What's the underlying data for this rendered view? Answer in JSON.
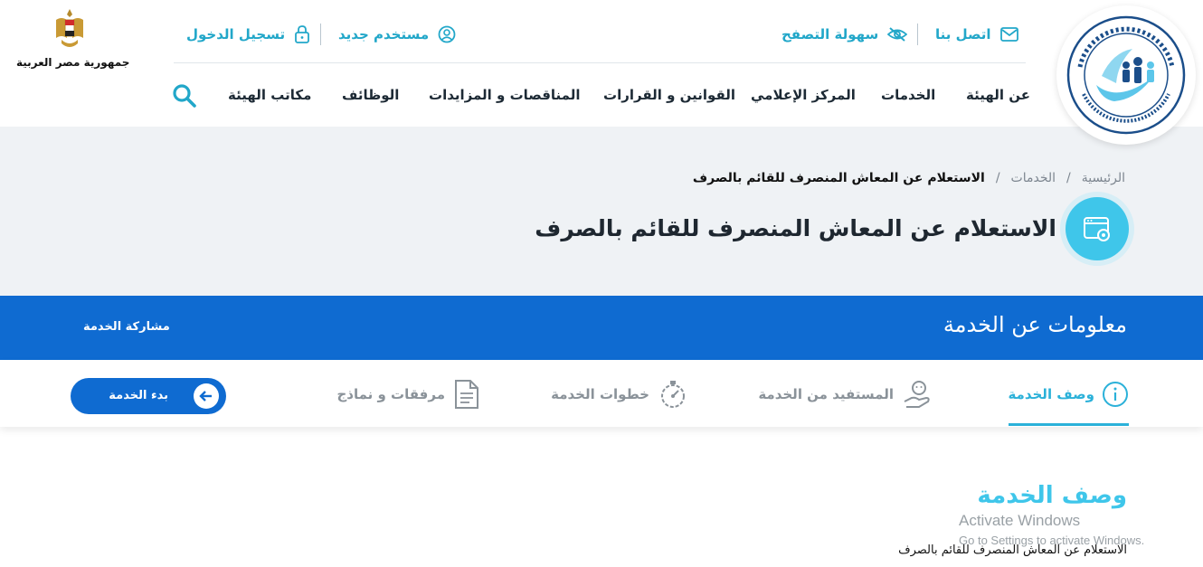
{
  "topbar": {
    "contact": "اتصل بنا",
    "accessibility": "سهولة التصفح",
    "new_user": "مستخدم جديد",
    "login": "تسجيل الدخول"
  },
  "nav": {
    "items": [
      "عن الهيئة",
      "الخدمات",
      "المركز الإعلامي",
      "القوانين و القرارات",
      "المناقصات و المزايدات",
      "الوظائف",
      "مكاتب الهيئة"
    ]
  },
  "emblem": {
    "label": "جمهورية مصر العربية"
  },
  "breadcrumb": {
    "home": "الرئيسية",
    "separator": "/",
    "services": "الخدمات",
    "current": "الاستعلام عن المعاش المنصرف للقائم بالصرف"
  },
  "page": {
    "title": "الاستعلام عن المعاش المنصرف للقائم بالصرف"
  },
  "infobar": {
    "title": "معلومات عن الخدمة",
    "share": "مشاركة الخدمة"
  },
  "tabs": [
    {
      "label": "وصف الخدمة",
      "icon": "info-icon",
      "active": true
    },
    {
      "label": "المستفيد من الخدمة",
      "icon": "beneficiary-icon",
      "active": false
    },
    {
      "label": "خطوات الخدمة",
      "icon": "steps-icon",
      "active": false
    },
    {
      "label": "مرفقات و نماذج",
      "icon": "document-icon",
      "active": false
    }
  ],
  "start_button": {
    "label": "بدء الخدمة"
  },
  "section": {
    "title": "وصف الخدمة",
    "body": "الاستعلام عن المعاش المنصرف للقائم بالصرف"
  },
  "watermark": {
    "title": "Activate Windows",
    "subtitle": "Go to Settings to activate Windows."
  },
  "colors": {
    "accent": "#2bb1d9",
    "primary_blue": "#0f6bd1",
    "hero_bg": "#eff2f5",
    "dark_text": "#1e2730"
  }
}
